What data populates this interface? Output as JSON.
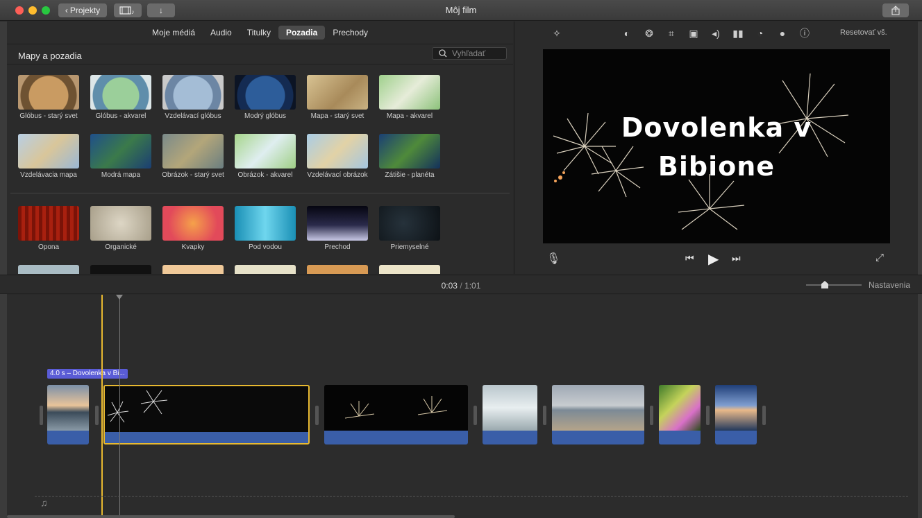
{
  "window": {
    "title": "Môj film",
    "back_button": "Projekty",
    "traffic_colors": [
      "#fe5f57",
      "#febc2e",
      "#28c840"
    ]
  },
  "browser": {
    "tabs": [
      {
        "label": "Moje médiá"
      },
      {
        "label": "Audio"
      },
      {
        "label": "Titulky"
      },
      {
        "label": "Pozadia",
        "active": true
      },
      {
        "label": "Prechody"
      }
    ],
    "section_title": "Mapy a pozadia",
    "search_placeholder": "Vyhľadať",
    "maps": [
      {
        "label": "Glóbus - starý svet"
      },
      {
        "label": "Glóbus - akvarel"
      },
      {
        "label": "Vzdelávací glóbus"
      },
      {
        "label": "Modrý glóbus"
      },
      {
        "label": "Mapa - starý svet"
      },
      {
        "label": "Mapa - akvarel"
      },
      {
        "label": "Vzdelávacia mapa"
      },
      {
        "label": "Modrá mapa"
      },
      {
        "label": "Obrázok - starý svet"
      },
      {
        "label": "Obrázok - akvarel"
      },
      {
        "label": "Vzdelávací obrázok"
      },
      {
        "label": "Zátišie - planéta"
      }
    ],
    "backgrounds": [
      {
        "label": "Opona"
      },
      {
        "label": "Organické"
      },
      {
        "label": "Kvapky"
      },
      {
        "label": "Pod vodou"
      },
      {
        "label": "Prechod"
      },
      {
        "label": "Priemyselné"
      }
    ]
  },
  "viewer": {
    "reset_label": "Resetovať vš.",
    "title_overlay_line1": "Dovolenka v",
    "title_overlay_line2": "Bibione",
    "tool_icons": [
      "color-balance-icon",
      "color-correction-icon",
      "crop-icon",
      "stabilization-icon",
      "volume-icon",
      "equalizer-icon",
      "speed-icon",
      "filter-icon",
      "info-icon"
    ]
  },
  "timeline": {
    "current_time": "0:03",
    "separator": "/",
    "total_time": "1:01",
    "settings_label": "Nastavenia",
    "clip_label": "4.0 s – Dovolenka v Bi..."
  }
}
